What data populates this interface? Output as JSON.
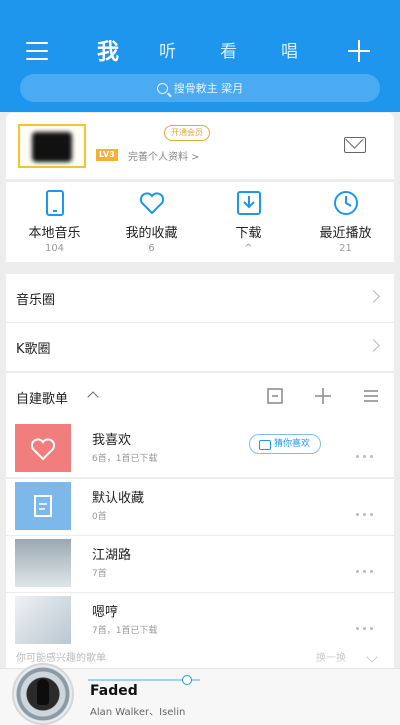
{
  "header": {
    "tabs": [
      "我",
      "听",
      "看",
      "唱"
    ],
    "active_tab": "我",
    "search_placeholder": "搜骨敕主 梁月"
  },
  "profile": {
    "vip_badge": "开通会员",
    "level": "LV3",
    "complete_link": "完善个人资料 >"
  },
  "quick_actions": [
    {
      "label": "本地音乐",
      "count": "104",
      "icon": "phone-icon"
    },
    {
      "label": "我的收藏",
      "count": "6",
      "icon": "heart-icon"
    },
    {
      "label": "下载",
      "count": "^",
      "icon": "download-icon"
    },
    {
      "label": "最近播放",
      "count": "21",
      "icon": "clock-icon"
    }
  ],
  "rows": [
    {
      "label": "音乐圈"
    },
    {
      "label": "K歌圈"
    }
  ],
  "playlists_header": {
    "title": "自建歌单"
  },
  "playlists": [
    {
      "name": "我喜欢",
      "meta": "6首，1首已下载",
      "color": "#f27d7d",
      "action": "猜你喜欢"
    },
    {
      "name": "默认收藏",
      "meta": "0首",
      "color": "#7cb8ea",
      "action": ""
    },
    {
      "name": "江湖路",
      "meta": "7首",
      "color": "#bfc7cc",
      "action": ""
    },
    {
      "name": "嗯哼",
      "meta": "7首，1首已下载",
      "color": "#dfe5ea",
      "action": ""
    }
  ],
  "recommendation": {
    "text": "你可能感兴趣的歌单",
    "action": "换一换"
  },
  "player": {
    "title": "Faded",
    "artist": "Alan Walker、Iselin",
    "progress": 0.88
  }
}
